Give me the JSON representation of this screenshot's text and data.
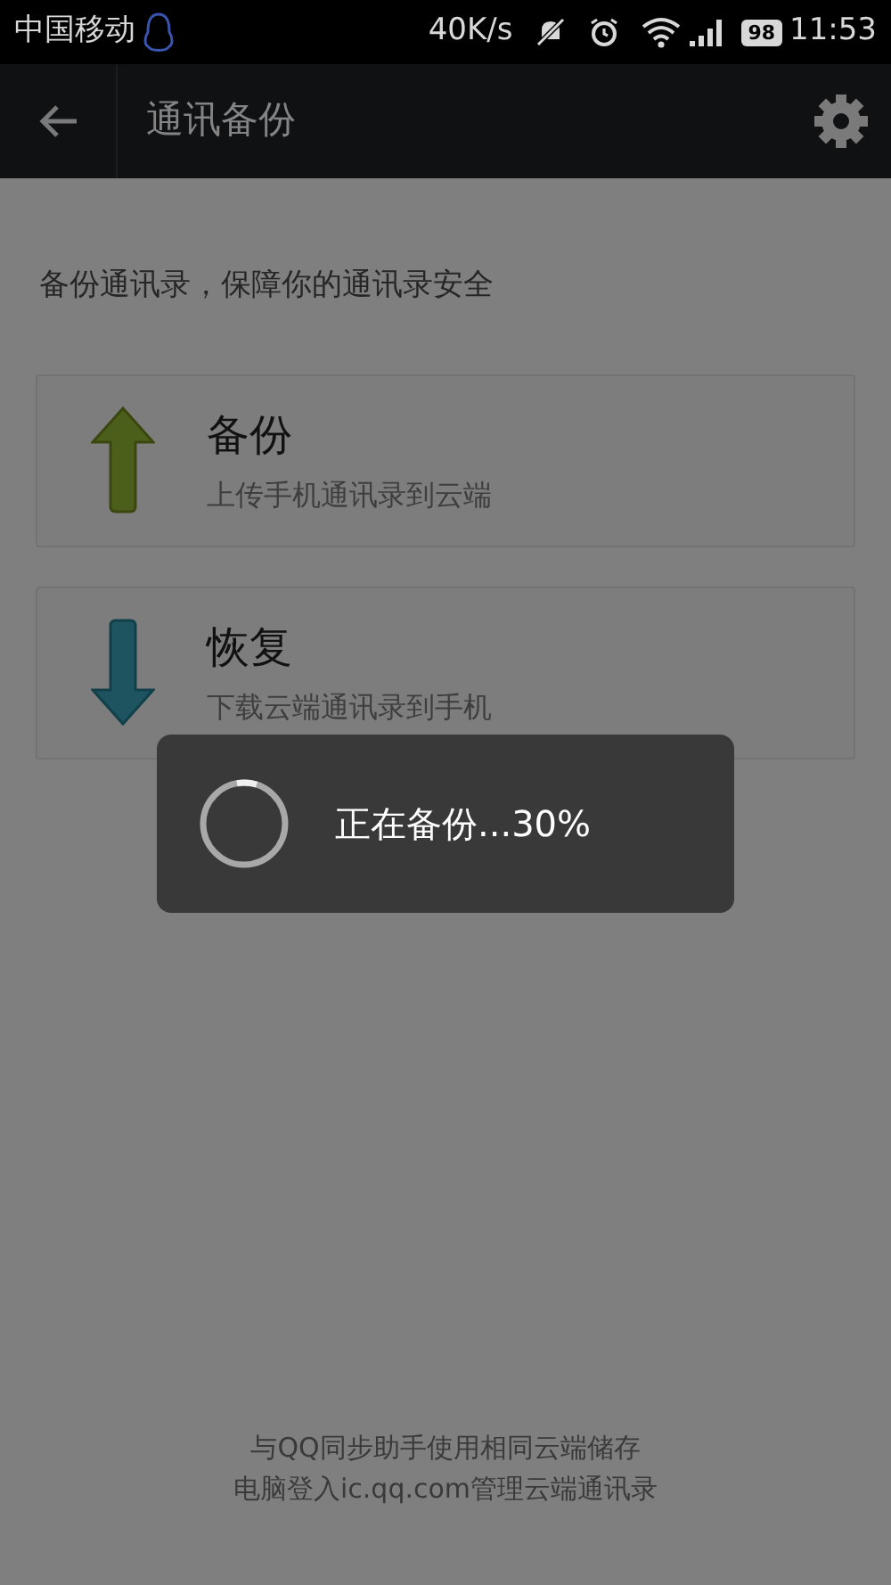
{
  "status_bar": {
    "carrier": "中国移动",
    "speed": "40K/s",
    "battery": "98",
    "time": "11:53"
  },
  "toolbar": {
    "title": "通讯备份"
  },
  "description": "备份通讯录，保障你的通讯录安全",
  "options": [
    {
      "kind": "up",
      "title": "备份",
      "subtitle": "上传手机通讯录到云端"
    },
    {
      "kind": "down",
      "title": "恢复",
      "subtitle": "下载云端通讯录到手机"
    }
  ],
  "footer": [
    "与QQ同步助手使用相同云端储存",
    "电脑登入ic.qq.com管理云端通讯录"
  ],
  "dialog": {
    "message": "正在备份...30%"
  }
}
